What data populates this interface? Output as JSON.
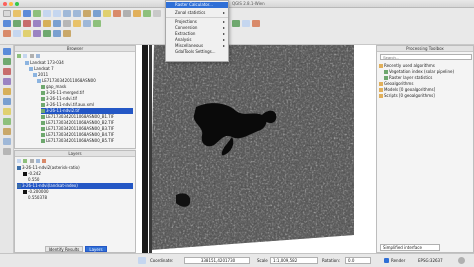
{
  "window": {
    "title": "QGIS 2.8.1-Wien"
  },
  "raster_menu": {
    "items": [
      {
        "label": "Raster Calculator...",
        "selected": true,
        "has_submenu": false
      },
      {
        "label": "Zonal statistics",
        "has_submenu": true
      },
      {
        "label": "Projections",
        "has_submenu": true
      },
      {
        "label": "Conversion",
        "has_submenu": true
      },
      {
        "label": "Extraction",
        "has_submenu": true
      },
      {
        "label": "Analysis",
        "has_submenu": true
      },
      {
        "label": "Miscellaneous",
        "has_submenu": true
      },
      {
        "label": "GdalTools Settings...",
        "has_submenu": false
      }
    ],
    "submenu_arrow": "▸"
  },
  "browser": {
    "title": "Browser",
    "items": [
      {
        "label": "Landsat 173-034",
        "level": 2
      },
      {
        "label": "Landsat 7",
        "level": 3
      },
      {
        "label": "2011",
        "level": 4
      },
      {
        "label": "LE71730342011068ASN00",
        "level": 5
      },
      {
        "label": "gap_mask",
        "level": 6
      },
      {
        "label": "3-26-11-merged.tif",
        "level": 6
      },
      {
        "label": "3-26-11-ndvi.tif",
        "level": 6
      },
      {
        "label": "3-26-11-ndvi.tif.aux.xml",
        "level": 6
      },
      {
        "label": "3-26-11-ndvi2.tif",
        "level": 6,
        "selected": true
      },
      {
        "label": "LE71730342011068ASN00_B1.TIF",
        "level": 6
      },
      {
        "label": "LE71730342011068ASN00_B2.TIF",
        "level": 6
      },
      {
        "label": "LE71730342011068ASN00_B3.TIF",
        "level": 6
      },
      {
        "label": "LE71730342011068ASN00_B4.TIF",
        "level": 6
      },
      {
        "label": "LE71730342011068ASN00_B5.TIF",
        "level": 6
      }
    ]
  },
  "layers": {
    "title": "Layers",
    "items": [
      {
        "label": "3-26-11-ndvi2(asterisk-ratio)",
        "type": "layer"
      },
      {
        "label": "-0.242",
        "type": "value"
      },
      {
        "label": "0.550",
        "type": "value"
      },
      {
        "label": "3-26-11-ndvi(landsat-index)",
        "type": "layer",
        "selected": true
      },
      {
        "label": "-0.200000",
        "type": "value"
      },
      {
        "label": "0.550378",
        "type": "value"
      }
    ],
    "tabs": [
      "Identify Results",
      "Layers"
    ],
    "active_tab": "Layers"
  },
  "processing": {
    "title": "Processing Toolbox",
    "search_placeholder": "Search...",
    "items": [
      {
        "label": "Recently used algorithms",
        "level": 0
      },
      {
        "label": "Vegetation index (solar pipeline)",
        "level": 1
      },
      {
        "label": "Raster layer statistics",
        "level": 1
      },
      {
        "label": "Geoalgorithms",
        "level": 0
      },
      {
        "label": "Models [0 geoalgorithms]",
        "level": 0
      },
      {
        "label": "Scripts [0 geoalgorithms]",
        "level": 0
      }
    ],
    "interface_label": "Simplified interface"
  },
  "status": {
    "coordinate_label": "Coordinate:",
    "coordinate_value": "338151,4201730",
    "scale_label": "Scale",
    "scale_value": "1:1,009,582",
    "rotation_label": "Rotation:",
    "rotation_value": "0.0",
    "render_label": "Render",
    "crs_label": "EPSG:32637"
  },
  "colors": {
    "selection": "#2457c5",
    "panel": "#f4f4f4",
    "canvas": "#ffffff"
  }
}
